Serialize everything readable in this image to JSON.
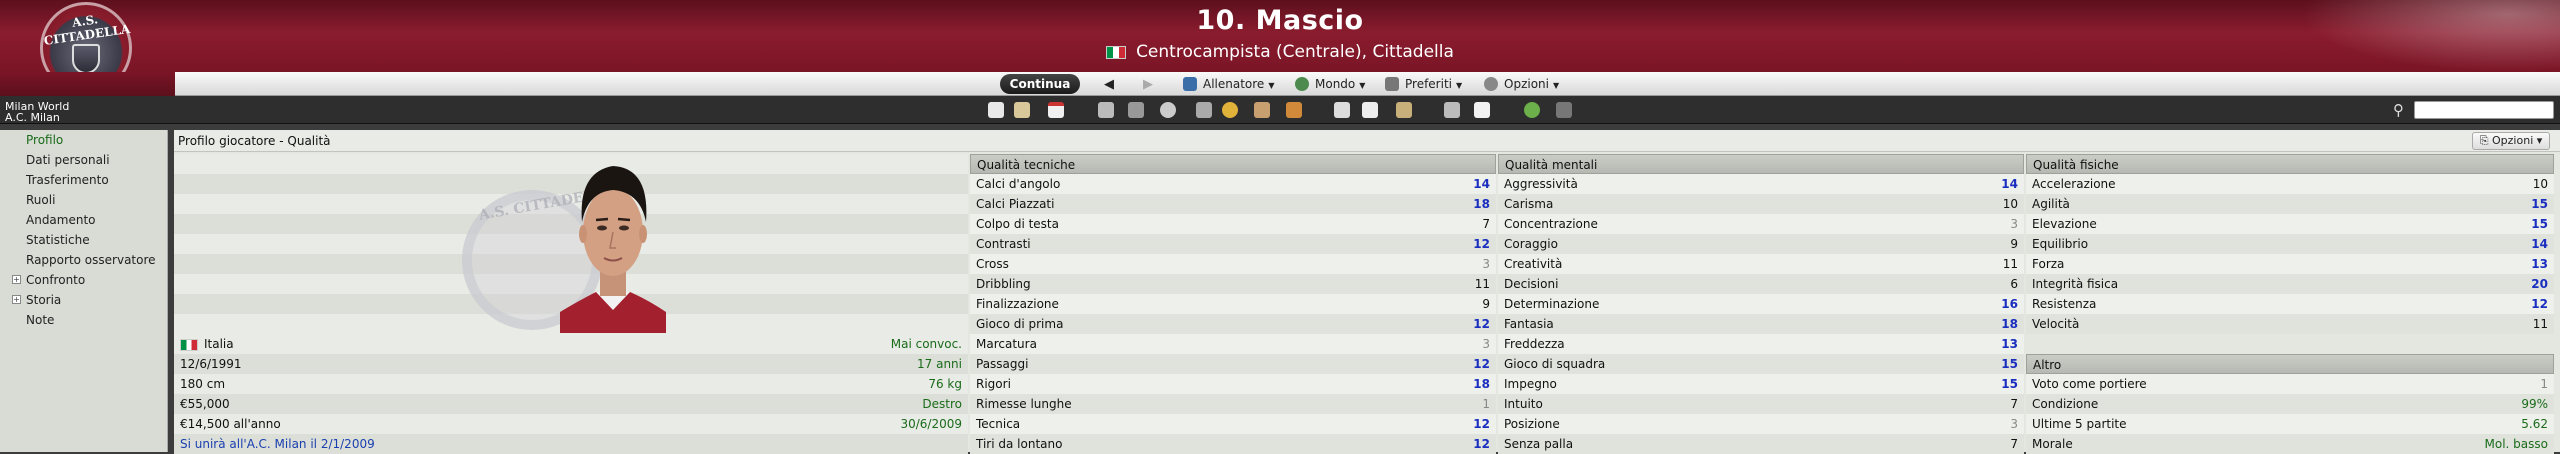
{
  "header": {
    "club_badge_text": "A.S. CITTADELLA",
    "player_title": "10. Mascio",
    "player_subtitle": "Centrocampista (Centrale), Cittadella"
  },
  "menubar": {
    "continue_label": "Continua",
    "menus": [
      "Allenatore",
      "Mondo",
      "Preferiti",
      "Opzioni"
    ]
  },
  "breadcrumb": {
    "game": "Milan World",
    "team": "A.C. Milan"
  },
  "search": {
    "placeholder": ""
  },
  "sidebar": {
    "items": [
      {
        "label": "Profilo",
        "active": true,
        "expandable": false
      },
      {
        "label": "Dati personali",
        "active": false,
        "expandable": false
      },
      {
        "label": "Trasferimento",
        "active": false,
        "expandable": false
      },
      {
        "label": "Ruoli",
        "active": false,
        "expandable": false
      },
      {
        "label": "Andamento",
        "active": false,
        "expandable": false
      },
      {
        "label": "Statistiche",
        "active": false,
        "expandable": false
      },
      {
        "label": "Rapporto osservatore",
        "active": false,
        "expandable": false
      },
      {
        "label": "Confronto",
        "active": false,
        "expandable": true
      },
      {
        "label": "Storia",
        "active": false,
        "expandable": true
      },
      {
        "label": "Note",
        "active": false,
        "expandable": false
      }
    ]
  },
  "panel": {
    "title": "Profilo giocatore - Qualità",
    "options_label": "Opzioni"
  },
  "info": {
    "rows": [
      {
        "left": "Italia",
        "right": "Mai convoc."
      },
      {
        "left": "12/6/1991",
        "right": "17 anni"
      },
      {
        "left": "180 cm",
        "right": "76 kg"
      },
      {
        "left": "€55,000",
        "right": "Destro"
      },
      {
        "left": "€14,500 all'anno",
        "right": "30/6/2009"
      },
      {
        "left": "Si unirà all'A.C. Milan il 2/1/2009",
        "right": ""
      }
    ]
  },
  "technical": {
    "heading": "Qualità tecniche",
    "rows": [
      {
        "name": "Calci d'angolo",
        "value": "14"
      },
      {
        "name": "Calci Piazzati",
        "value": "18"
      },
      {
        "name": "Colpo di testa",
        "value": "7"
      },
      {
        "name": "Contrasti",
        "value": "12"
      },
      {
        "name": "Cross",
        "value": "3"
      },
      {
        "name": "Dribbling",
        "value": "11"
      },
      {
        "name": "Finalizzazione",
        "value": "9"
      },
      {
        "name": "Gioco di prima",
        "value": "12"
      },
      {
        "name": "Marcatura",
        "value": "3"
      },
      {
        "name": "Passaggi",
        "value": "12"
      },
      {
        "name": "Rigori",
        "value": "18"
      },
      {
        "name": "Rimesse lunghe",
        "value": "1"
      },
      {
        "name": "Tecnica",
        "value": "12"
      },
      {
        "name": "Tiri da lontano",
        "value": "12"
      }
    ]
  },
  "mental": {
    "heading": "Qualità mentali",
    "rows": [
      {
        "name": "Aggressività",
        "value": "14"
      },
      {
        "name": "Carisma",
        "value": "10"
      },
      {
        "name": "Concentrazione",
        "value": "3"
      },
      {
        "name": "Coraggio",
        "value": "9"
      },
      {
        "name": "Creatività",
        "value": "11"
      },
      {
        "name": "Decisioni",
        "value": "6"
      },
      {
        "name": "Determinazione",
        "value": "16"
      },
      {
        "name": "Fantasia",
        "value": "18"
      },
      {
        "name": "Freddezza",
        "value": "13"
      },
      {
        "name": "Gioco di squadra",
        "value": "15"
      },
      {
        "name": "Impegno",
        "value": "15"
      },
      {
        "name": "Intuito",
        "value": "7"
      },
      {
        "name": "Posizione",
        "value": "3"
      },
      {
        "name": "Senza palla",
        "value": "7"
      }
    ]
  },
  "physical": {
    "heading": "Qualità fisiche",
    "rows": [
      {
        "name": "Accelerazione",
        "value": "10"
      },
      {
        "name": "Agilità",
        "value": "15"
      },
      {
        "name": "Elevazione",
        "value": "15"
      },
      {
        "name": "Equilibrio",
        "value": "14"
      },
      {
        "name": "Forza",
        "value": "13"
      },
      {
        "name": "Integrità fisica",
        "value": "20"
      },
      {
        "name": "Resistenza",
        "value": "12"
      },
      {
        "name": "Velocità",
        "value": "11"
      }
    ]
  },
  "other": {
    "heading": "Altro",
    "rows": [
      {
        "name": "Voto come portiere",
        "value": "1"
      },
      {
        "name": "Condizione",
        "value": "99%"
      },
      {
        "name": "Ultime 5 partite",
        "value": "5.62"
      },
      {
        "name": "Morale",
        "value": "Mol. basso"
      }
    ]
  },
  "colors": {
    "header_red": "#8a1c2e",
    "high_value_blue": "#1a2fc0",
    "positive_green": "#1a6b1a"
  },
  "icons": [
    "home-icon",
    "inbox-icon",
    "calendar-icon",
    "squad-icon",
    "tactics-icon",
    "training-icon",
    "staff-icon",
    "finance-icon",
    "news-icon",
    "transfers-icon",
    "trophy-icon",
    "fixtures-icon",
    "scout-icon",
    "manager-icon",
    "notes-icon",
    "help-icon",
    "print-icon"
  ]
}
